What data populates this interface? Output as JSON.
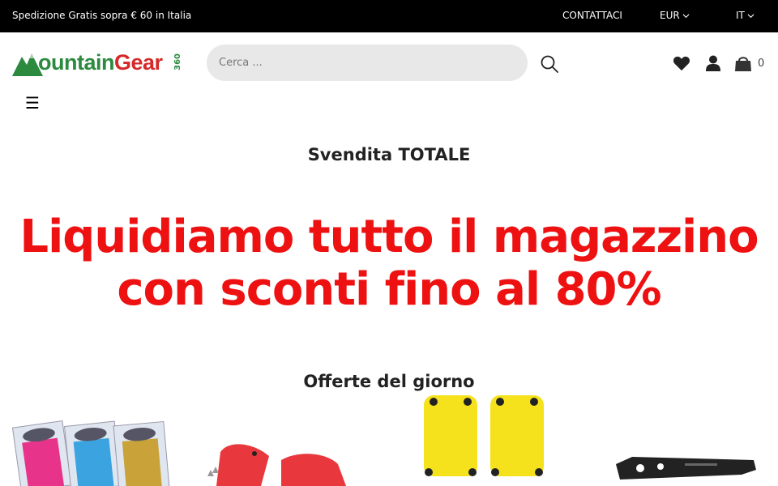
{
  "topbar": {
    "shipping": "Spedizione Gratis sopra € 60 in Italia",
    "contact": "CONTATTACI",
    "currency": "EUR",
    "language": "IT"
  },
  "header": {
    "logo_text_green": "ountain",
    "logo_text_red": "Gear",
    "logo_suffix": "360",
    "search_placeholder": "Cerca ...",
    "cart_count": "0",
    "menu_glyph": "☰",
    "icons": [
      "search-icon",
      "heart-icon",
      "user-icon",
      "cart-icon",
      "menu-icon"
    ]
  },
  "main": {
    "sale_title": "Svendita TOTALE",
    "hero_line1": "Liquidiamo tutto il magazzino",
    "hero_line2": "con sconti fino al 80%",
    "offers_title": "Offerte del giorno"
  },
  "colors": {
    "topbar_bg": "#000000",
    "brand_green": "#2b8a3e",
    "brand_red": "#d62828",
    "hero_red": "#ee1111"
  }
}
